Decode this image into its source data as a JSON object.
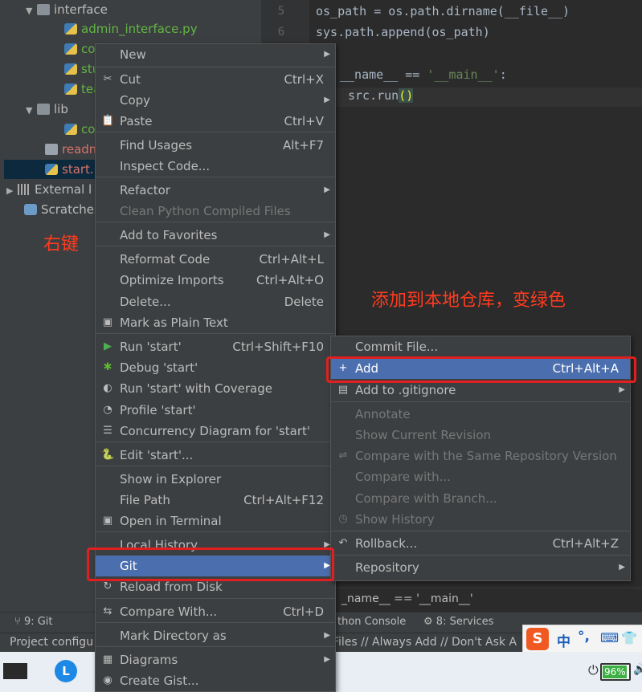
{
  "tree": {
    "interface": "interface",
    "admin_interface": "admin_interface.py",
    "f_co": "co",
    "f_stu": "stu",
    "f_tea": "tea",
    "lib": "lib",
    "lib_co": "co",
    "readme": "readm",
    "start": "start.p",
    "external": "External l",
    "scratches": "Scratches"
  },
  "editor": {
    "line5": "5",
    "line6": "6",
    "code1": "os_path = os.path.dirname(__file__)",
    "code2": "sys.path.append(os_path)",
    "code3_a": "__name__ == ",
    "code3_b": "'__main__'",
    "code3_c": ":",
    "code4_a": "src.run",
    "code4_b": "()",
    "breadcrumb": "_name__ == '__main__'"
  },
  "annotations": {
    "right_click": "右键",
    "add_note": "添加到本地仓库，变绿色"
  },
  "context_menu": [
    {
      "label": "New",
      "shortcut": "",
      "submenu": true
    },
    {
      "label": "Cut",
      "shortcut": "Ctrl+X",
      "icon": "✂"
    },
    {
      "label": "Copy",
      "shortcut": "",
      "submenu": true
    },
    {
      "label": "Paste",
      "shortcut": "Ctrl+V",
      "icon": "📋"
    },
    {
      "label": "Find Usages",
      "shortcut": "Alt+F7"
    },
    {
      "label": "Inspect Code...",
      "shortcut": ""
    },
    {
      "label": "Refactor",
      "shortcut": "",
      "submenu": true
    },
    {
      "label": "Clean Python Compiled Files",
      "shortcut": "",
      "disabled": true
    },
    {
      "label": "Add to Favorites",
      "shortcut": "",
      "submenu": true
    },
    {
      "label": "Reformat Code",
      "shortcut": "Ctrl+Alt+L"
    },
    {
      "label": "Optimize Imports",
      "shortcut": "Ctrl+Alt+O"
    },
    {
      "label": "Delete...",
      "shortcut": "Delete"
    },
    {
      "label": "Mark as Plain Text",
      "shortcut": ""
    },
    {
      "label": "Run 'start'",
      "shortcut": "Ctrl+Shift+F10"
    },
    {
      "label": "Debug 'start'",
      "shortcut": ""
    },
    {
      "label": "Run 'start' with Coverage",
      "shortcut": ""
    },
    {
      "label": "Profile 'start'",
      "shortcut": ""
    },
    {
      "label": "Concurrency Diagram for 'start'",
      "shortcut": ""
    },
    {
      "label": "Edit 'start'...",
      "shortcut": ""
    },
    {
      "label": "Show in Explorer",
      "shortcut": ""
    },
    {
      "label": "File Path",
      "shortcut": "Ctrl+Alt+F12"
    },
    {
      "label": "Open in Terminal",
      "shortcut": ""
    },
    {
      "label": "Local History",
      "shortcut": "",
      "submenu": true
    },
    {
      "label": "Git",
      "shortcut": "",
      "submenu": true,
      "active": true
    },
    {
      "label": "Reload from Disk",
      "shortcut": ""
    },
    {
      "label": "Compare With...",
      "shortcut": "Ctrl+D"
    },
    {
      "label": "Mark Directory as",
      "shortcut": "",
      "submenu": true
    },
    {
      "label": "Diagrams",
      "shortcut": "",
      "submenu": true
    },
    {
      "label": "Create Gist...",
      "shortcut": ""
    }
  ],
  "git_menu": [
    {
      "label": "Commit File...",
      "shortcut": ""
    },
    {
      "label": "Add",
      "shortcut": "Ctrl+Alt+A",
      "active": true
    },
    {
      "label": "Add to .gitignore",
      "shortcut": "",
      "submenu": true
    },
    {
      "label": "Annotate",
      "shortcut": "",
      "disabled": true
    },
    {
      "label": "Show Current Revision",
      "shortcut": "",
      "disabled": true
    },
    {
      "label": "Compare with the Same Repository Version",
      "shortcut": "",
      "disabled": true
    },
    {
      "label": "Compare with...",
      "shortcut": "",
      "disabled": true
    },
    {
      "label": "Compare with Branch...",
      "shortcut": "",
      "disabled": true
    },
    {
      "label": "Show History",
      "shortcut": "",
      "disabled": true
    },
    {
      "label": "Rollback...",
      "shortcut": "Ctrl+Alt+Z"
    },
    {
      "label": "Repository",
      "shortcut": "",
      "submenu": true
    }
  ],
  "toolbar": {
    "git_tab": "9: Git",
    "python_console": "thon Console",
    "services": "8: Services"
  },
  "statusbar": {
    "left": "Project configu",
    "right": "Files // Always Add // Don't Ask A"
  },
  "taskbar": {
    "ime_cn": "中",
    "ime_punct": "°,",
    "battery": "96%"
  },
  "colors": {
    "menu_bg": "#3c3f41",
    "selection": "#4b6eaf",
    "highlight_box": "#e02020",
    "annotation_text": "#ff3b1f"
  }
}
